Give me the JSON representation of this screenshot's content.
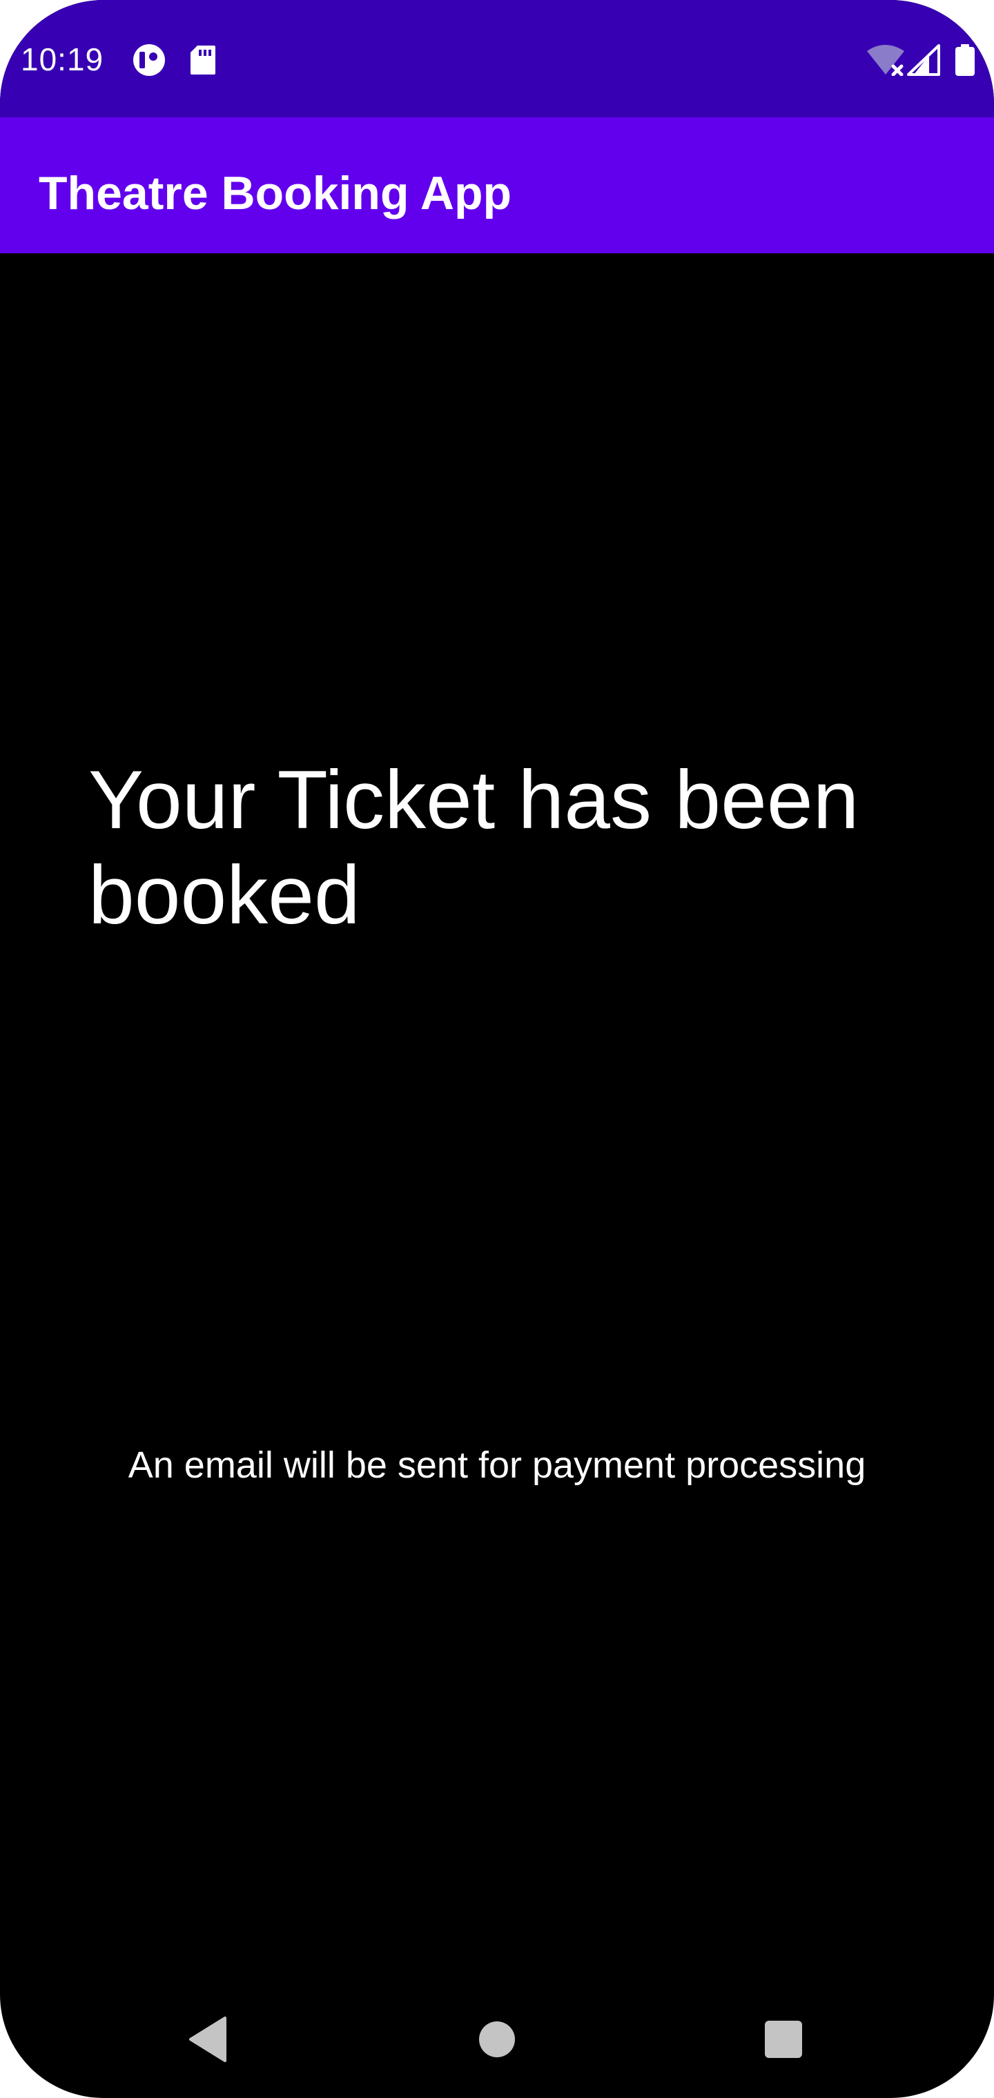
{
  "status_bar": {
    "time": "10:19",
    "icons_left": [
      "record-app-icon",
      "sd-card-icon"
    ],
    "icons_right": [
      "wifi-off-icon",
      "cellular-signal-icon",
      "battery-icon"
    ],
    "color": "#3700B3"
  },
  "app_bar": {
    "title": "Theatre Booking App",
    "color": "#6200EE"
  },
  "content": {
    "headline": "Your Ticket has been booked",
    "message": "An email will be sent for payment processing",
    "background": "#000000"
  },
  "nav_bar": {
    "buttons": [
      "back-icon",
      "home-icon",
      "recents-icon"
    ]
  }
}
